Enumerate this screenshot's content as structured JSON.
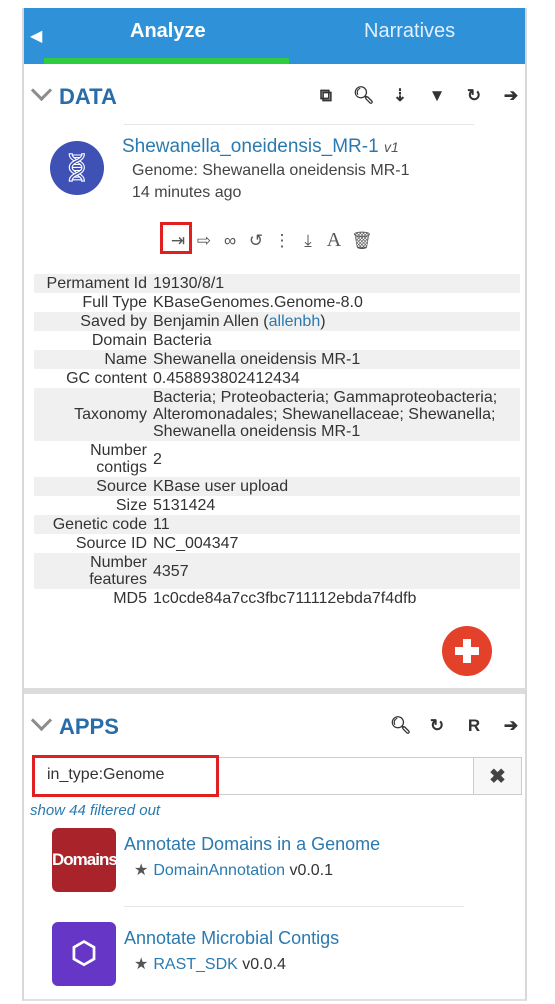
{
  "tabs": {
    "back_icon": "chevron-left-icon",
    "active": "Analyze",
    "other": "Narratives"
  },
  "data_panel": {
    "title": "DATA",
    "tools": [
      "copy-icon",
      "search-icon",
      "sort-icon",
      "filter-icon",
      "refresh-icon",
      "arrow-right-icon"
    ],
    "object": {
      "name": "Shewanella_oneidensis_MR-1",
      "version": "v1",
      "type_line": "Genome: Shewanella oneidensis MR-1",
      "time": "14 minutes ago",
      "icon": "dna-icon"
    },
    "actions": [
      "import-icon",
      "export-icon",
      "binoculars-icon",
      "history-icon",
      "provenance-icon",
      "download-icon",
      "rename-icon",
      "trash-icon"
    ],
    "metadata": [
      {
        "key": "Permament Id",
        "value": "19130/8/1"
      },
      {
        "key": "Full Type",
        "value": "KBaseGenomes.Genome-8.0"
      },
      {
        "key": "Saved by",
        "value": "Benjamin Allen",
        "link": "allenbh"
      },
      {
        "key": "Domain",
        "value": "Bacteria"
      },
      {
        "key": "Name",
        "value": "Shewanella oneidensis MR-1"
      },
      {
        "key": "GC content",
        "value": "0.458893802412434"
      },
      {
        "key": "Taxonomy",
        "value": "Bacteria; Proteobacteria; Gammaproteobacteria; Alteromonadales; Shewanellaceae; Shewanella; Shewanella oneidensis MR-1"
      },
      {
        "key": "Number contigs",
        "value": "2"
      },
      {
        "key": "Source",
        "value": "KBase user upload"
      },
      {
        "key": "Size",
        "value": "5131424"
      },
      {
        "key": "Genetic code",
        "value": "11"
      },
      {
        "key": "Source ID",
        "value": "NC_004347"
      },
      {
        "key": "Number features",
        "value": "4357"
      },
      {
        "key": "MD5",
        "value": "1c0cde84a7cc3fbc711112ebda7f4dfb"
      }
    ],
    "fab_icon": "plus-circle-icon",
    "colors": {
      "accent": "#2a7ab0",
      "tab_bar": "#2f92d8",
      "active_tab_line": "#2ecc40",
      "fab": "#e4412b"
    }
  },
  "apps_panel": {
    "title": "APPS",
    "tools": [
      "search-icon",
      "refresh-icon",
      "r-icon",
      "arrow-right-icon"
    ],
    "search_value": "in_type:Genome",
    "clear_icon": "close-icon",
    "filtered_text": "show 44 filtered out",
    "apps": [
      {
        "icon_text": "Domains",
        "title": "Annotate Domains in a Genome",
        "module": "DomainAnnotation",
        "version": "v0.0.1"
      },
      {
        "icon_text": "⬡",
        "title": "Annotate Microbial Contigs",
        "module": "RAST_SDK",
        "version": "v0.0.4"
      }
    ]
  }
}
